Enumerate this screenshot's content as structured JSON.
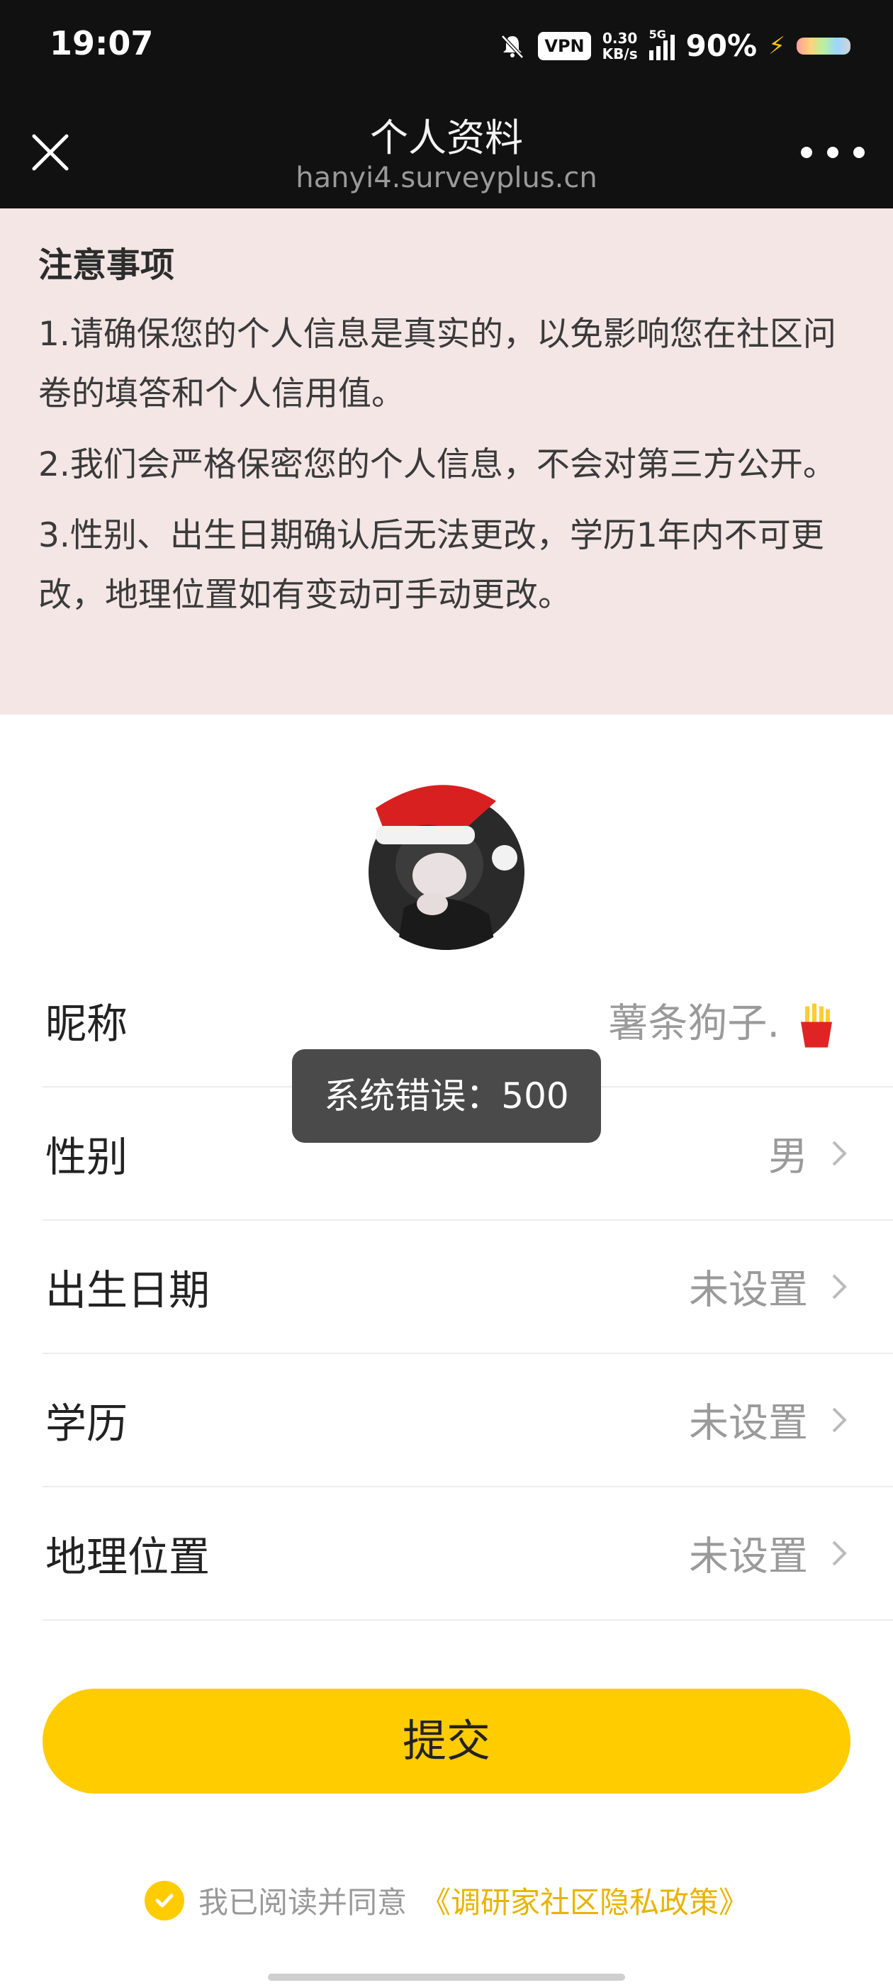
{
  "status_bar": {
    "time": "19:07",
    "vpn": "VPN",
    "speed_value": "0.30",
    "speed_unit": "KB/s",
    "network": "5G",
    "battery": "90%"
  },
  "nav": {
    "title": "个人资料",
    "url": "hanyi4.surveyplus.cn",
    "close_icon": "close-icon",
    "more_icon": "more-icon"
  },
  "notice": {
    "title": "注意事项",
    "items": [
      "1.请确保您的个人信息是真实的，以免影响您在社区问卷的填答和个人信用值。",
      "2.我们会严格保密您的个人信息，不会对第三方公开。",
      "3.性别、出生日期确认后无法更改，学历1年内不可更改，地理位置如有变动可手动更改。"
    ]
  },
  "profile": {
    "rows": [
      {
        "label": "昵称",
        "value": "薯条狗子."
      },
      {
        "label": "性别",
        "value": "男"
      },
      {
        "label": "出生日期",
        "value": "未设置"
      },
      {
        "label": "学历",
        "value": "未设置"
      },
      {
        "label": "地理位置",
        "value": "未设置"
      }
    ]
  },
  "toast": {
    "message": "系统错误：500"
  },
  "submit": {
    "label": "提交"
  },
  "agreement": {
    "text": "我已阅读并同意",
    "link": "《调研家社区隐私政策》"
  },
  "colors": {
    "accent": "#ffcc00",
    "notice_bg": "#f3e6e4",
    "header_bg": "#111111"
  }
}
